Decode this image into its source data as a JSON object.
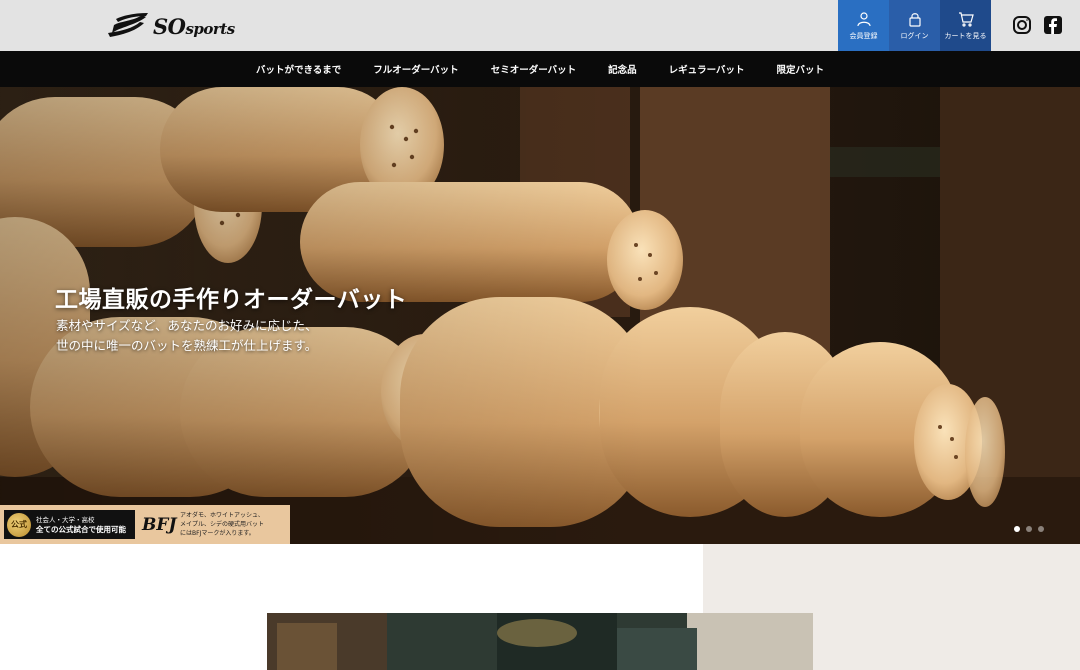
{
  "brand": {
    "logo_text": "SO",
    "logo_sub": "sports"
  },
  "account": {
    "register_label": "会員登録",
    "login_label": "ログイン",
    "cart_label": "カートを見る"
  },
  "sns": {
    "instagram_icon": "instagram-icon",
    "facebook_icon": "facebook-icon"
  },
  "nav": {
    "items": [
      {
        "label": "バットができるまで"
      },
      {
        "label": "フルオーダーバット"
      },
      {
        "label": "セミオーダーバット"
      },
      {
        "label": "記念品"
      },
      {
        "label": "レギュラーバット"
      },
      {
        "label": "限定バット"
      }
    ]
  },
  "hero": {
    "title": "工場直販の手作りオーダーバット",
    "subtitle_line1": "素材やサイズなど、あなたのお好みに応じた、",
    "subtitle_line2": "世の中に唯一のバットを熟練工が仕上げます。",
    "slides": 3,
    "active_slide": 1
  },
  "badge": {
    "medal_text": "公式",
    "line1": "社会人・大学・高校",
    "line2": "全ての公式試合で使用可能",
    "bfj_logo": "BFJ",
    "bfj_line1": "アオダモ、ホワイトアッシュ、",
    "bfj_line2": "メイプル、シデの硬式用バット",
    "bfj_line3": "にはBFJマークが入ります。"
  },
  "colors": {
    "topbar": "#e3e3e3",
    "nav": "#0a0a0a",
    "register": "#2a6fc2",
    "login": "#2a5ea9",
    "cart": "#1f4a8b",
    "badge": "#e9c79e"
  }
}
